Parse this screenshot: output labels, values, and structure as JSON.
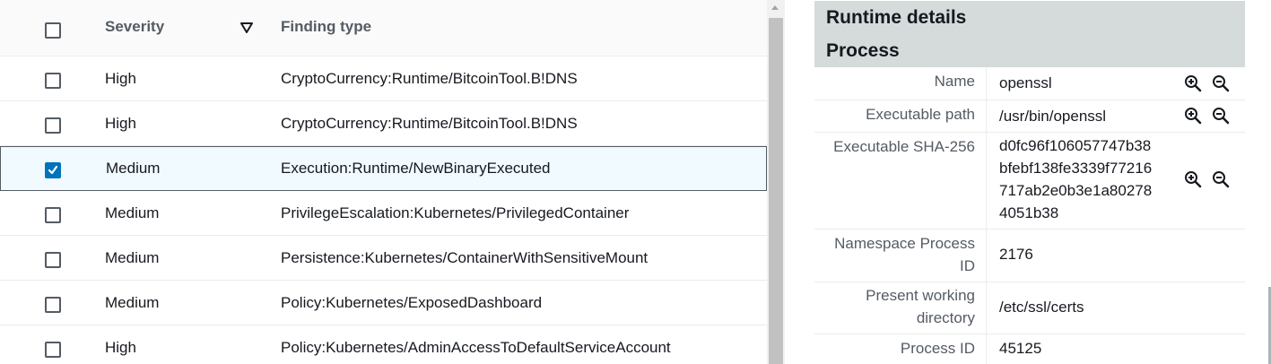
{
  "findings_table": {
    "headers": {
      "severity": "Severity",
      "finding_type": "Finding type"
    },
    "rows": [
      {
        "severity": "High",
        "type": "CryptoCurrency:Runtime/BitcoinTool.B!DNS",
        "checked": false
      },
      {
        "severity": "High",
        "type": "CryptoCurrency:Runtime/BitcoinTool.B!DNS",
        "checked": false
      },
      {
        "severity": "Medium",
        "type": "Execution:Runtime/NewBinaryExecuted",
        "checked": true
      },
      {
        "severity": "Medium",
        "type": "PrivilegeEscalation:Kubernetes/PrivilegedContainer",
        "checked": false
      },
      {
        "severity": "Medium",
        "type": "Persistence:Kubernetes/ContainerWithSensitiveMount",
        "checked": false
      },
      {
        "severity": "Medium",
        "type": "Policy:Kubernetes/ExposedDashboard",
        "checked": false
      },
      {
        "severity": "High",
        "type": "Policy:Kubernetes/AdminAccessToDefaultServiceAccount",
        "checked": false
      }
    ]
  },
  "details_panel": {
    "title": "Runtime details",
    "section": "Process",
    "fields": [
      {
        "key": "Name",
        "value": "openssl"
      },
      {
        "key": "Executable path",
        "value": "/usr/bin/openssl"
      },
      {
        "key": "Executable SHA-256",
        "value_lines": [
          "d0fc96f106057747b38",
          "bfebf138fe3339f77216",
          "717ab2e0b3e1a80278",
          "4051b38"
        ]
      },
      {
        "key_lines": [
          "Namespace Process",
          "ID"
        ],
        "value": "2176"
      },
      {
        "key_lines": [
          "Present working",
          "directory"
        ],
        "value": "/etc/ssl/certs"
      },
      {
        "key": "Process ID",
        "value": "45125"
      }
    ]
  },
  "colors": {
    "accent": "#0073bb",
    "header_band": "#d5dbdb",
    "border": "#eaeded"
  },
  "icons": [
    "sort-descending-icon",
    "checkbox-icon",
    "checkmark-icon",
    "zoom-in-icon",
    "zoom-out-icon"
  ]
}
